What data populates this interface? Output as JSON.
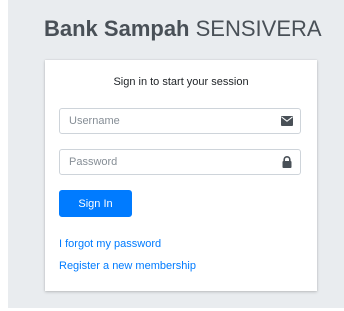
{
  "logo": {
    "brand": "Bank Sampah",
    "brand_light": "SENSIVERA"
  },
  "login": {
    "message": "Sign in to start your session",
    "username": {
      "placeholder": "Username",
      "value": "",
      "icon": "envelope-icon"
    },
    "password": {
      "placeholder": "Password",
      "value": "",
      "icon": "lock-icon"
    },
    "signin_label": "Sign In",
    "forgot_label": "I forgot my password",
    "register_label": "Register a new membership"
  },
  "colors": {
    "background": "#e9ecef",
    "primary": "#007bff",
    "text": "#495057",
    "icon": "#495057"
  }
}
